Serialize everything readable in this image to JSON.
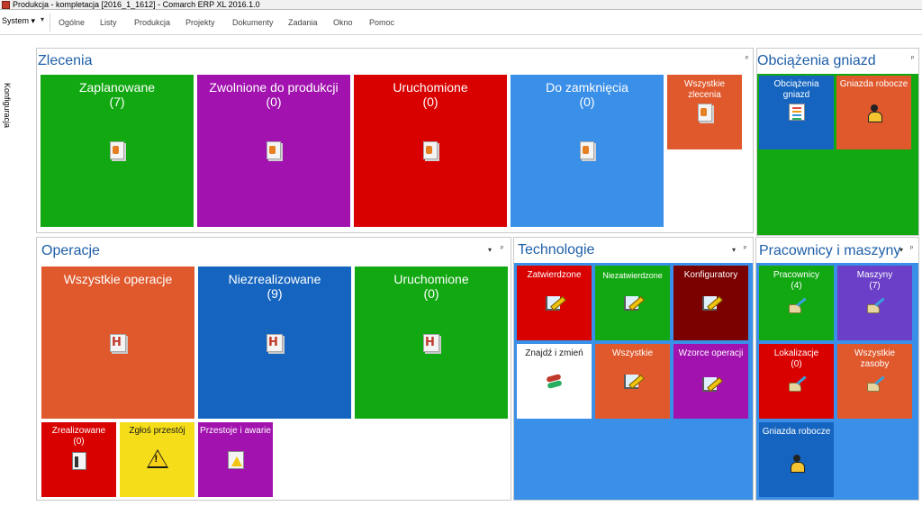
{
  "window": {
    "title": "Produkcja - kompletacja [2016_1_1612] - Comarch ERP XL 2016.1.0"
  },
  "menu": {
    "system": "System",
    "quick_access": "▾",
    "items": [
      "Ogólne",
      "Listy",
      "Produkcja",
      "Projekty",
      "Dokumenty",
      "Zadania",
      "Okno",
      "Pomoc"
    ]
  },
  "sidebar": {
    "label": "Konfiguracja"
  },
  "zlecenia": {
    "title": "Zlecenia",
    "tiles": [
      {
        "label": "Zaplanowane",
        "count": "(7)"
      },
      {
        "label": "Zwolnione do produkcji",
        "count": "(0)"
      },
      {
        "label": "Uruchomione",
        "count": "(0)"
      },
      {
        "label": "Do zamknięcia",
        "count": "(0)"
      },
      {
        "label": "Wszystkie zlecenia"
      }
    ]
  },
  "obciazenia": {
    "title": "Obciążenia gniazd",
    "tiles": [
      {
        "label": "Obciążenia gniazd"
      },
      {
        "label": "Gniazda robocze"
      }
    ]
  },
  "operacje": {
    "title": "Operacje",
    "tiles": [
      {
        "label": "Wszystkie operacje"
      },
      {
        "label": "Niezrealizowane",
        "count": "(9)"
      },
      {
        "label": "Uruchomione",
        "count": "(0)"
      },
      {
        "label": "Zrealizowane",
        "count": "(0)"
      },
      {
        "label": "Zgłoś przestój"
      },
      {
        "label": "Przestoje i awarie"
      }
    ]
  },
  "technologie": {
    "title": "Technologie",
    "tiles": [
      {
        "label": "Zatwierdzone"
      },
      {
        "label": "Niezatwierdzone"
      },
      {
        "label": "Konfiguratory"
      },
      {
        "label": "Znajdź i zmień"
      },
      {
        "label": "Wszystkie"
      },
      {
        "label": "Wzorce operacji"
      }
    ]
  },
  "pracownicy": {
    "title": "Pracownicy i maszyny",
    "tiles": [
      {
        "label": "Pracownicy",
        "count": "(4)"
      },
      {
        "label": "Maszyny",
        "count": "(7)"
      },
      {
        "label": "Lokalizacje",
        "count": "(0)"
      },
      {
        "label": "Wszystkie zasoby"
      },
      {
        "label": "Gniazda robocze"
      }
    ]
  },
  "colors": {
    "green": "#12a812",
    "purple": "#a112ae",
    "red": "#d90000",
    "blue_light": "#3a8fe8",
    "orange": "#e0592c",
    "blue_dark": "#1565c0",
    "maroon": "#7b0000",
    "yellow": "#f5dd1a",
    "violet": "#6b3fc7",
    "title_blue": "#1e5fa8"
  },
  "pin_glyph": "ᵖ",
  "dropdown_glyph": "▾"
}
